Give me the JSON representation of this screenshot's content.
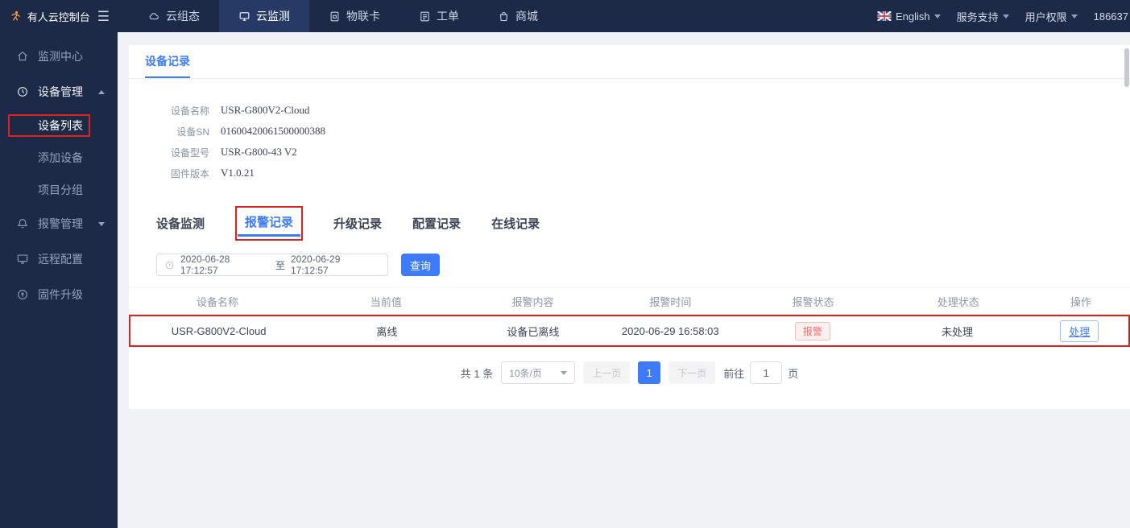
{
  "colors": {
    "accent": "#3e7bfa",
    "annotation": "#e01f1f",
    "alarm": "#f56c6c",
    "navy": "#1c2947"
  },
  "topbar": {
    "logo_text": "有人云控制台",
    "nav": [
      {
        "label": "云组态"
      },
      {
        "label": "云监测"
      },
      {
        "label": "物联卡"
      },
      {
        "label": "工单"
      },
      {
        "label": "商城"
      }
    ],
    "language": "English",
    "support": "服务支持",
    "permission": "用户权限",
    "account": "186637"
  },
  "sidebar": {
    "items": [
      {
        "label": "监测中心"
      },
      {
        "label": "设备管理"
      },
      {
        "label": "报警管理"
      },
      {
        "label": "远程配置"
      },
      {
        "label": "固件升级"
      }
    ],
    "device_children": [
      {
        "label": "设备列表"
      },
      {
        "label": "添加设备"
      },
      {
        "label": "项目分组"
      }
    ]
  },
  "main": {
    "card_tab": "设备记录",
    "info": [
      {
        "label": "设备名称",
        "value": "USR-G800V2-Cloud"
      },
      {
        "label": "设备SN",
        "value": "01600420061500000388"
      },
      {
        "label": "设备型号",
        "value": "USR-G800-43 V2"
      },
      {
        "label": "固件版本",
        "value": "V1.0.21"
      }
    ],
    "tabs": [
      {
        "label": "设备监测"
      },
      {
        "label": "报警记录"
      },
      {
        "label": "升级记录"
      },
      {
        "label": "配置记录"
      },
      {
        "label": "在线记录"
      }
    ],
    "filter": {
      "start": "2020-06-28 17:12:57",
      "to": "至",
      "end": "2020-06-29 17:12:57",
      "search": "查询"
    },
    "table": {
      "headers": [
        "设备名称",
        "当前值",
        "报警内容",
        "报警时间",
        "报警状态",
        "处理状态",
        "操作"
      ],
      "rows": [
        {
          "name": "USR-G800V2-Cloud",
          "current": "离线",
          "content": "设备已离线",
          "time": "2020-06-29 16:58:03",
          "alarm_status": "报警",
          "handle_status": "未处理",
          "action": "处理"
        }
      ]
    },
    "pagination": {
      "total": "共 1 条",
      "page_size": "10条/页",
      "prev": "上一页",
      "page": "1",
      "next": "下一页",
      "goto_before": "前往",
      "goto_value": "1",
      "goto_after": "页"
    }
  }
}
